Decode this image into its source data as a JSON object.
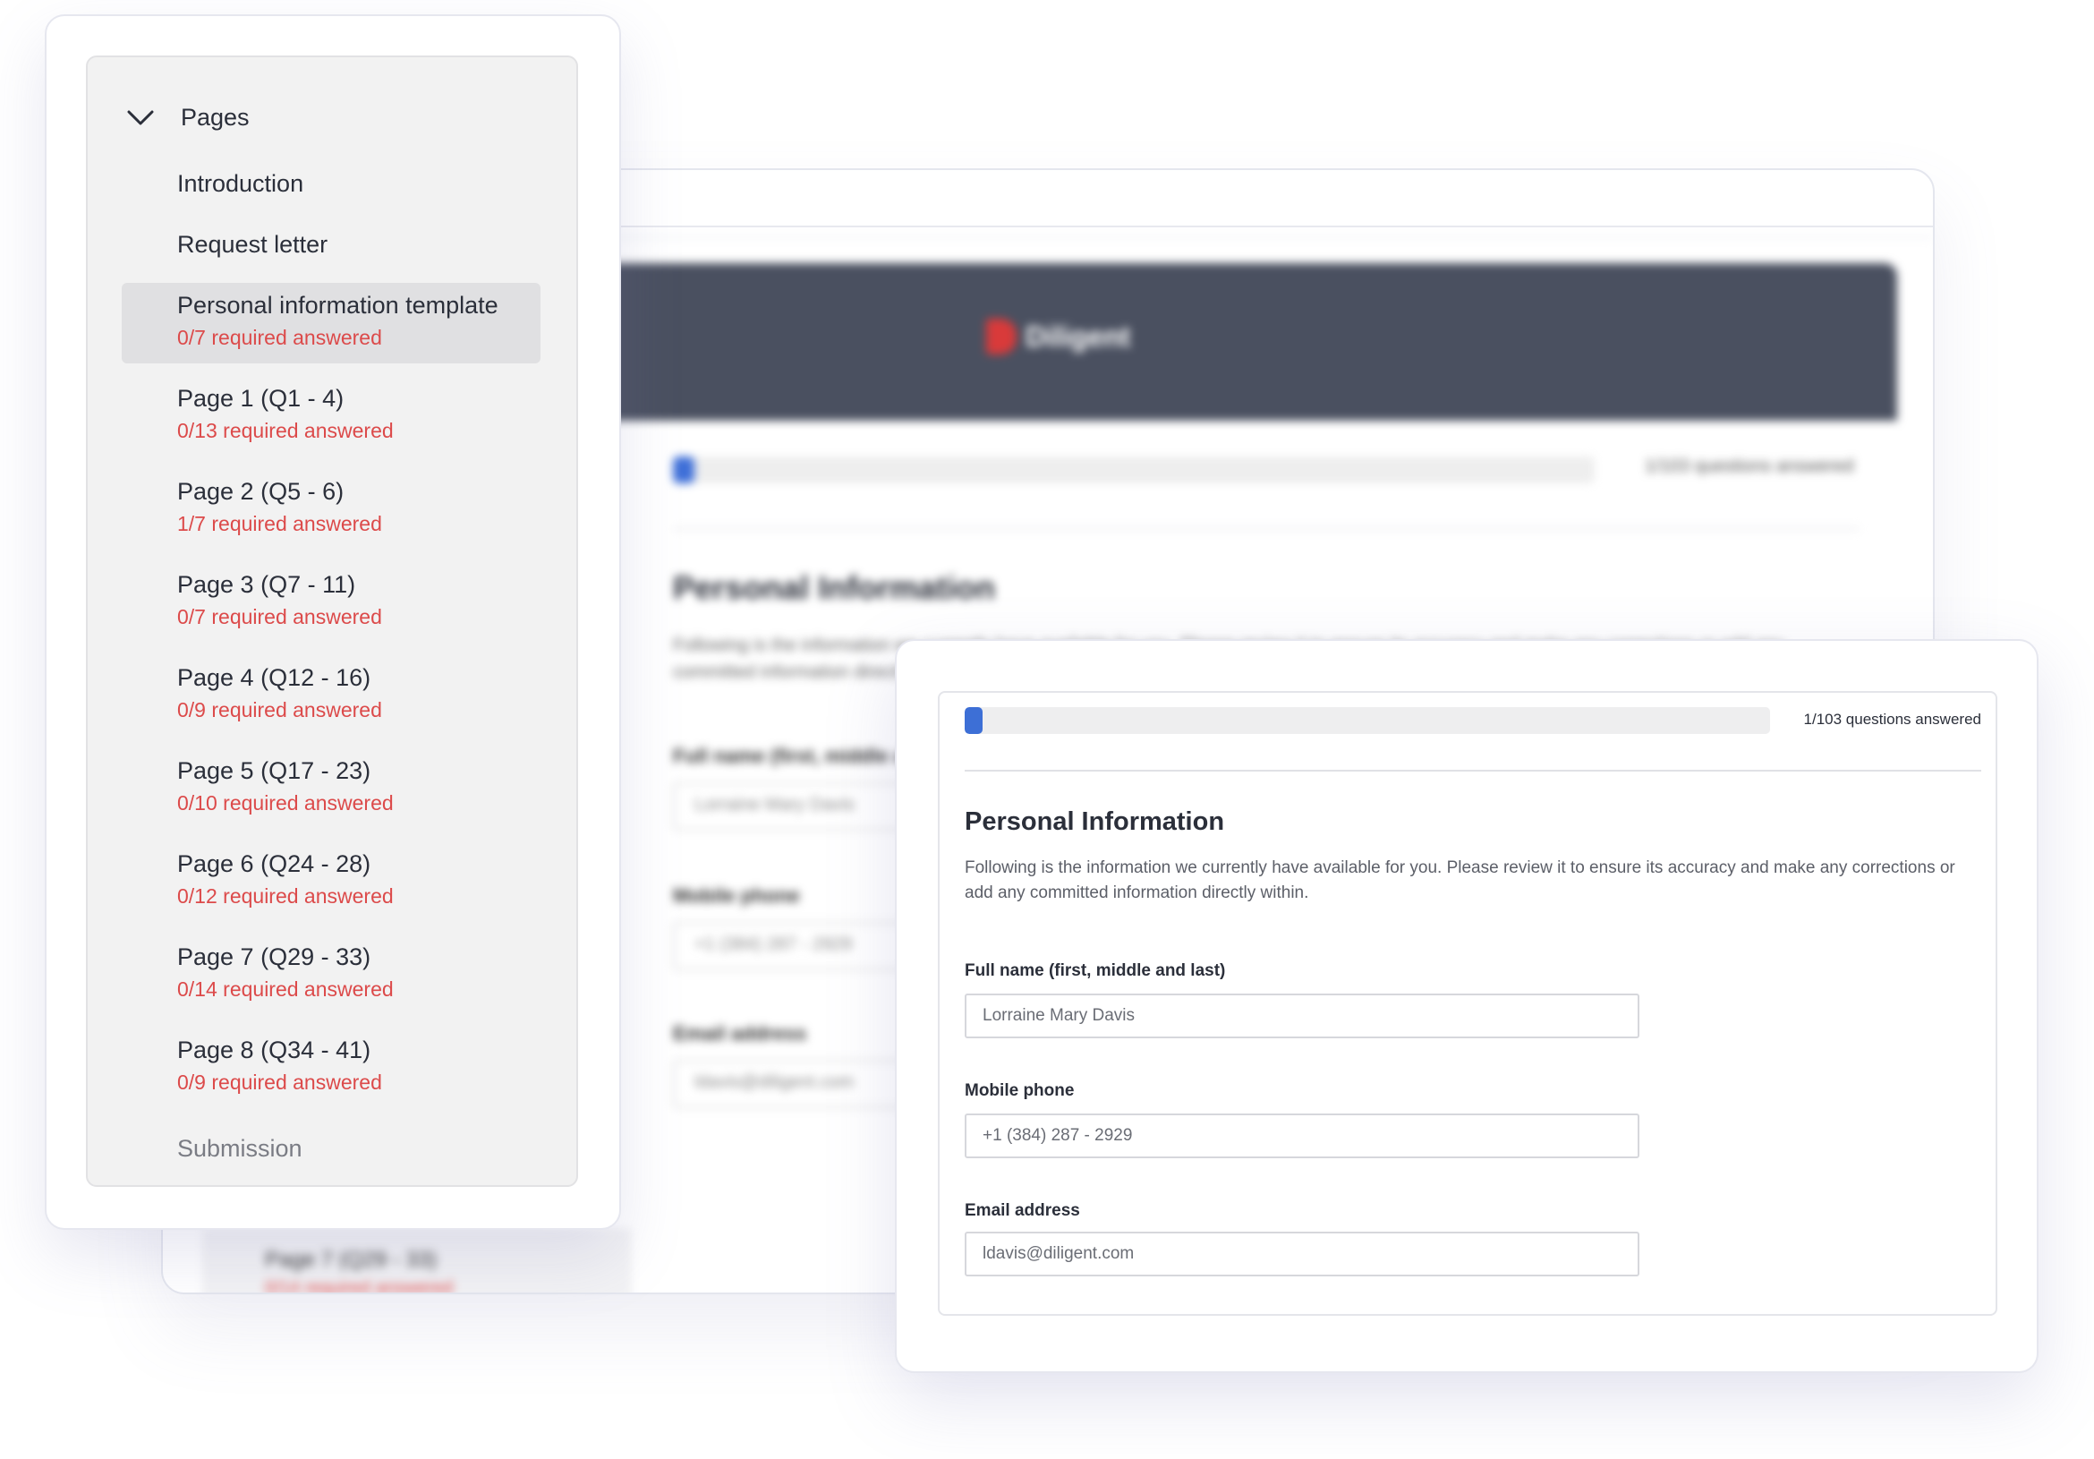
{
  "background_window": {
    "brand": "Diligent",
    "progress_label": "1/103 questions answered",
    "progress_fraction": 0.023,
    "title": "Personal Information",
    "description": "Following is the information we currently have available for you. Please review it to ensure its accuracy and make any corrections or add any committed information directly within.",
    "fields": [
      {
        "label": "Full name (first, middle and last)",
        "value": "Lorraine Mary Davis"
      },
      {
        "label": "Mobile phone",
        "value": "+1 (384) 287 - 2929"
      },
      {
        "label": "Email address",
        "value": "ldavis@diligent.com"
      }
    ],
    "sidebar_peek": {
      "title": "Page 7 (Q29 - 33)",
      "subtitle": "0/14 required answered"
    }
  },
  "sidebar": {
    "header": "Pages",
    "items_simple": [
      "Introduction",
      "Request letter"
    ],
    "items": [
      {
        "title": "Personal information template",
        "subtitle": "0/7 required answered",
        "active": true
      },
      {
        "title": "Page 1 (Q1 - 4)",
        "subtitle": "0/13 required answered"
      },
      {
        "title": "Page 2 (Q5 - 6)",
        "subtitle": "1/7 required answered"
      },
      {
        "title": "Page 3 (Q7 - 11)",
        "subtitle": "0/7 required answered"
      },
      {
        "title": "Page 4 (Q12 - 16)",
        "subtitle": "0/9 required answered"
      },
      {
        "title": "Page 5 (Q17 - 23)",
        "subtitle": "0/10 required answered"
      },
      {
        "title": "Page 6 (Q24 - 28)",
        "subtitle": "0/12 required answered"
      },
      {
        "title": "Page 7 (Q29 - 33)",
        "subtitle": "0/14 required answered"
      },
      {
        "title": "Page 8 (Q34 - 41)",
        "subtitle": "0/9 required answered"
      }
    ],
    "submission": "Submission"
  },
  "form": {
    "progress_label": "1/103 questions answered",
    "progress_fraction": 0.018,
    "title": "Personal Information",
    "description": "Following is the information we currently have available for you. Please review it to ensure its accuracy and make any corrections or add any committed information directly within.",
    "fields": [
      {
        "label": "Full name (first, middle and last)",
        "value": "Lorraine Mary Davis"
      },
      {
        "label": "Mobile phone",
        "value": "+1 (384) 287 - 2929"
      },
      {
        "label": "Email address",
        "value": "ldavis@diligent.com"
      }
    ]
  },
  "colors": {
    "accent": "#3d6fd6",
    "required_text": "#dc4a4a",
    "header_dark": "#4a5060",
    "brand_red": "#d93a3a"
  }
}
